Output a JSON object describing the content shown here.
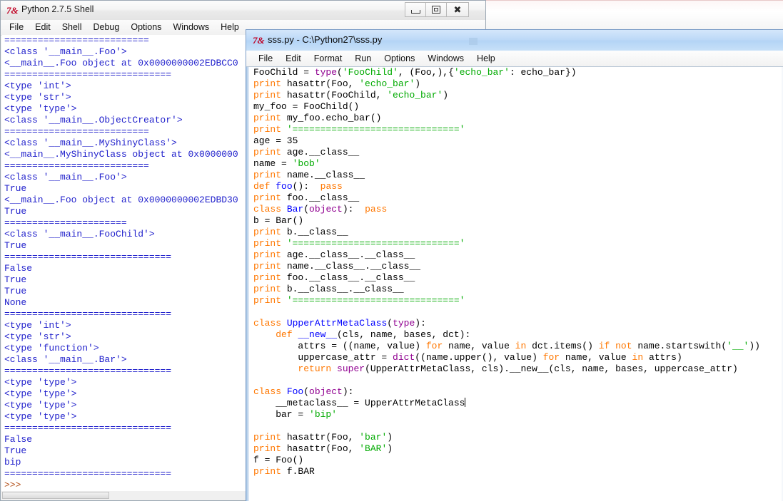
{
  "shell_window": {
    "title": "Python 2.7.5 Shell",
    "icon": "python-idle-icon",
    "menu": [
      "File",
      "Edit",
      "Shell",
      "Debug",
      "Options",
      "Windows",
      "Help"
    ],
    "controls": {
      "minimize": "minimize",
      "maximize": "maximize",
      "close": "close"
    },
    "output_lines": [
      "==========================",
      "<class '__main__.Foo'>",
      "<__main__.Foo object at 0x0000000002EDBCC0",
      "==============================",
      "<type 'int'>",
      "<type 'str'>",
      "<type 'type'>",
      "<class '__main__.ObjectCreator'>",
      "==========================",
      "<class '__main__.MyShinyClass'>",
      "<__main__.MyShinyClass object at 0x0000000",
      "==========================",
      "<class '__main__.Foo'>",
      "True",
      "<__main__.Foo object at 0x0000000002EDBD30",
      "True",
      "======================",
      "<class '__main__.FooChild'>",
      "True",
      "==============================",
      "False",
      "True",
      "True",
      "None",
      "==============================",
      "<type 'int'>",
      "<type 'str'>",
      "<type 'function'>",
      "<class '__main__.Bar'>",
      "==============================",
      "<type 'type'>",
      "<type 'type'>",
      "<type 'type'>",
      "<type 'type'>",
      "==============================",
      "False",
      "True",
      "bip",
      "=============================="
    ],
    "prompt": ">>>"
  },
  "editor_window": {
    "title": "sss.py - C:\\Python27\\sss.py",
    "icon": "python-idle-icon",
    "menu": [
      "File",
      "Edit",
      "Format",
      "Run",
      "Options",
      "Windows",
      "Help"
    ],
    "code_lines": [
      [
        {
          "t": "FooChild = ",
          "c": "plain"
        },
        {
          "t": "type",
          "c": "bi"
        },
        {
          "t": "(",
          "c": "plain"
        },
        {
          "t": "'FooChild'",
          "c": "str"
        },
        {
          "t": ", (Foo,),{",
          "c": "plain"
        },
        {
          "t": "'echo_bar'",
          "c": "str"
        },
        {
          "t": ": echo_bar})",
          "c": "plain"
        }
      ],
      [
        {
          "t": "print",
          "c": "kw"
        },
        {
          "t": " hasattr(Foo, ",
          "c": "plain"
        },
        {
          "t": "'echo_bar'",
          "c": "str"
        },
        {
          "t": ")",
          "c": "plain"
        }
      ],
      [
        {
          "t": "print",
          "c": "kw"
        },
        {
          "t": " hasattr(FooChild, ",
          "c": "plain"
        },
        {
          "t": "'echo_bar'",
          "c": "str"
        },
        {
          "t": ")",
          "c": "plain"
        }
      ],
      [
        {
          "t": "my_foo = FooChild()",
          "c": "plain"
        }
      ],
      [
        {
          "t": "print",
          "c": "kw"
        },
        {
          "t": " my_foo.echo_bar()",
          "c": "plain"
        }
      ],
      [
        {
          "t": "print",
          "c": "kw"
        },
        {
          "t": " ",
          "c": "plain"
        },
        {
          "t": "'=============================='",
          "c": "str"
        }
      ],
      [
        {
          "t": "age = 35",
          "c": "plain"
        }
      ],
      [
        {
          "t": "print",
          "c": "kw"
        },
        {
          "t": " age.__class__",
          "c": "plain"
        }
      ],
      [
        {
          "t": "name = ",
          "c": "plain"
        },
        {
          "t": "'bob'",
          "c": "str"
        }
      ],
      [
        {
          "t": "print",
          "c": "kw"
        },
        {
          "t": " name.__class__",
          "c": "plain"
        }
      ],
      [
        {
          "t": "def",
          "c": "kw"
        },
        {
          "t": " ",
          "c": "plain"
        },
        {
          "t": "foo",
          "c": "defn"
        },
        {
          "t": "():  ",
          "c": "plain"
        },
        {
          "t": "pass",
          "c": "kw"
        }
      ],
      [
        {
          "t": "print",
          "c": "kw"
        },
        {
          "t": " foo.__class__",
          "c": "plain"
        }
      ],
      [
        {
          "t": "class",
          "c": "kw"
        },
        {
          "t": " ",
          "c": "plain"
        },
        {
          "t": "Bar",
          "c": "defn"
        },
        {
          "t": "(",
          "c": "plain"
        },
        {
          "t": "object",
          "c": "bi"
        },
        {
          "t": "):  ",
          "c": "plain"
        },
        {
          "t": "pass",
          "c": "kw"
        }
      ],
      [
        {
          "t": "b = Bar()",
          "c": "plain"
        }
      ],
      [
        {
          "t": "print",
          "c": "kw"
        },
        {
          "t": " b.__class__",
          "c": "plain"
        }
      ],
      [
        {
          "t": "print",
          "c": "kw"
        },
        {
          "t": " ",
          "c": "plain"
        },
        {
          "t": "'=============================='",
          "c": "str"
        }
      ],
      [
        {
          "t": "print",
          "c": "kw"
        },
        {
          "t": " age.__class__.__class__",
          "c": "plain"
        }
      ],
      [
        {
          "t": "print",
          "c": "kw"
        },
        {
          "t": " name.__class__.__class__",
          "c": "plain"
        }
      ],
      [
        {
          "t": "print",
          "c": "kw"
        },
        {
          "t": " foo.__class__.__class__",
          "c": "plain"
        }
      ],
      [
        {
          "t": "print",
          "c": "kw"
        },
        {
          "t": " b.__class__.__class__",
          "c": "plain"
        }
      ],
      [
        {
          "t": "print",
          "c": "kw"
        },
        {
          "t": " ",
          "c": "plain"
        },
        {
          "t": "'=============================='",
          "c": "str"
        }
      ],
      [],
      [
        {
          "t": "class",
          "c": "kw"
        },
        {
          "t": " ",
          "c": "plain"
        },
        {
          "t": "UpperAttrMetaClass",
          "c": "defn"
        },
        {
          "t": "(",
          "c": "plain"
        },
        {
          "t": "type",
          "c": "bi"
        },
        {
          "t": "):",
          "c": "plain"
        }
      ],
      [
        {
          "t": "    ",
          "c": "plain"
        },
        {
          "t": "def",
          "c": "kw"
        },
        {
          "t": " ",
          "c": "plain"
        },
        {
          "t": "__new__",
          "c": "defn"
        },
        {
          "t": "(cls, name, bases, dct):",
          "c": "plain"
        }
      ],
      [
        {
          "t": "        attrs = ((name, value) ",
          "c": "plain"
        },
        {
          "t": "for",
          "c": "kw"
        },
        {
          "t": " name, value ",
          "c": "plain"
        },
        {
          "t": "in",
          "c": "kw"
        },
        {
          "t": " dct.items() ",
          "c": "plain"
        },
        {
          "t": "if",
          "c": "kw"
        },
        {
          "t": " ",
          "c": "plain"
        },
        {
          "t": "not",
          "c": "kw"
        },
        {
          "t": " name.startswith(",
          "c": "plain"
        },
        {
          "t": "'__'",
          "c": "str"
        },
        {
          "t": "))",
          "c": "plain"
        }
      ],
      [
        {
          "t": "        uppercase_attr = ",
          "c": "plain"
        },
        {
          "t": "dict",
          "c": "bi"
        },
        {
          "t": "((name.upper(), value) ",
          "c": "plain"
        },
        {
          "t": "for",
          "c": "kw"
        },
        {
          "t": " name, value ",
          "c": "plain"
        },
        {
          "t": "in",
          "c": "kw"
        },
        {
          "t": " attrs)",
          "c": "plain"
        }
      ],
      [
        {
          "t": "        ",
          "c": "plain"
        },
        {
          "t": "return",
          "c": "kw"
        },
        {
          "t": " ",
          "c": "plain"
        },
        {
          "t": "super",
          "c": "bi"
        },
        {
          "t": "(UpperAttrMetaClass, cls).__new__(cls, name, bases, uppercase_attr)",
          "c": "plain"
        }
      ],
      [],
      [
        {
          "t": "class",
          "c": "kw"
        },
        {
          "t": " ",
          "c": "plain"
        },
        {
          "t": "Foo",
          "c": "defn"
        },
        {
          "t": "(",
          "c": "plain"
        },
        {
          "t": "object",
          "c": "bi"
        },
        {
          "t": "):",
          "c": "plain"
        }
      ],
      [
        {
          "t": "    __metaclass__ = UpperAttrMetaClass",
          "c": "plain"
        },
        {
          "t": "|CURSOR|",
          "c": "cursor"
        }
      ],
      [
        {
          "t": "    bar = ",
          "c": "plain"
        },
        {
          "t": "'bip'",
          "c": "str"
        }
      ],
      [],
      [
        {
          "t": "print",
          "c": "kw"
        },
        {
          "t": " hasattr(Foo, ",
          "c": "plain"
        },
        {
          "t": "'bar'",
          "c": "str"
        },
        {
          "t": ")",
          "c": "plain"
        }
      ],
      [
        {
          "t": "print",
          "c": "kw"
        },
        {
          "t": " hasattr(Foo, ",
          "c": "plain"
        },
        {
          "t": "'BAR'",
          "c": "str"
        },
        {
          "t": ")",
          "c": "plain"
        }
      ],
      [
        {
          "t": "f = Foo()",
          "c": "plain"
        }
      ],
      [
        {
          "t": "print",
          "c": "kw"
        },
        {
          "t": " f.BAR",
          "c": "plain"
        }
      ]
    ]
  },
  "colors": {
    "keyword": "#ff7700",
    "string": "#00aa00",
    "builtin": "#900090",
    "definition": "#0000ff",
    "shell_output": "#2222cc",
    "shell_prompt": "#b5531d",
    "active_titlebar": "#bcd9f7"
  }
}
